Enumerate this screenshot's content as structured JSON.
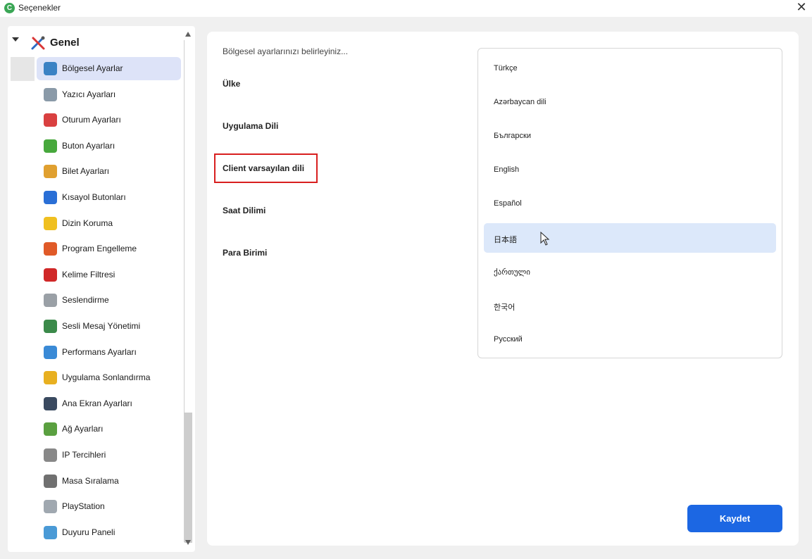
{
  "window": {
    "title": "Seçenekler",
    "app_icon_letter": "C"
  },
  "sidebar": {
    "group": {
      "label": "Genel"
    },
    "items": [
      {
        "label": "Bölgesel Ayarlar",
        "icon": "globe-icon",
        "color": "#3b82c4",
        "selected": true
      },
      {
        "label": "Yazıcı Ayarları",
        "icon": "printer-icon",
        "color": "#8a9aa8"
      },
      {
        "label": "Oturum Ayarları",
        "icon": "tools-icon",
        "color": "#d94040"
      },
      {
        "label": "Buton Ayarları",
        "icon": "check-icon",
        "color": "#47a83c"
      },
      {
        "label": "Bilet Ayarları",
        "icon": "ticket-icon",
        "color": "#e0a030"
      },
      {
        "label": "Kısayol Butonları",
        "icon": "play-icon",
        "color": "#2a6fd6"
      },
      {
        "label": "Dizin Koruma",
        "icon": "folder-shield-icon",
        "color": "#f0c020"
      },
      {
        "label": "Program Engelleme",
        "icon": "block-icon",
        "color": "#e05a28"
      },
      {
        "label": "Kelime Filtresi",
        "icon": "filter-icon",
        "color": "#d02828"
      },
      {
        "label": "Seslendirme",
        "icon": "speaker-icon",
        "color": "#9aa0a6"
      },
      {
        "label": "Sesli Mesaj Yönetimi",
        "icon": "headset-icon",
        "color": "#3b8a4a"
      },
      {
        "label": "Performans Ayarları",
        "icon": "performance-icon",
        "color": "#3a8ad6"
      },
      {
        "label": "Uygulama Sonlandırma",
        "icon": "broom-icon",
        "color": "#e8b020"
      },
      {
        "label": "Ana Ekran Ayarları",
        "icon": "monitor-icon",
        "color": "#3a4a60"
      },
      {
        "label": "Ağ Ayarları",
        "icon": "network-icon",
        "color": "#5aa040"
      },
      {
        "label": "IP Tercihleri",
        "icon": "ip-icon",
        "color": "#888888"
      },
      {
        "label": "Masa Sıralama",
        "icon": "grid-icon",
        "color": "#707070"
      },
      {
        "label": "PlayStation",
        "icon": "gamepad-icon",
        "color": "#a0a8b0"
      },
      {
        "label": "Duyuru Paneli",
        "icon": "announcement-icon",
        "color": "#4a9ad6"
      }
    ]
  },
  "main": {
    "intro": "Bölgesel ayarlarınızı belirleyiniz...",
    "settings": [
      {
        "label": "Ülke"
      },
      {
        "label": "Uygulama Dili"
      },
      {
        "label": "Client varsayılan dili",
        "highlighted": true
      },
      {
        "label": "Saat Dilimi"
      },
      {
        "label": "Para Birimi"
      }
    ],
    "languages": [
      {
        "label": "Türkçe"
      },
      {
        "label": "Azərbaycan dili"
      },
      {
        "label": "Български"
      },
      {
        "label": "English"
      },
      {
        "label": "Español"
      },
      {
        "label": "日本語",
        "hovered": true
      },
      {
        "label": "ქართული"
      },
      {
        "label": "한국어"
      },
      {
        "label": "Русский"
      }
    ],
    "save_label": "Kaydet"
  },
  "colors": {
    "accent": "#1c67e3",
    "selection": "#dde3f8",
    "hover": "#dce8fa",
    "highlight_border": "#d81f1f"
  }
}
